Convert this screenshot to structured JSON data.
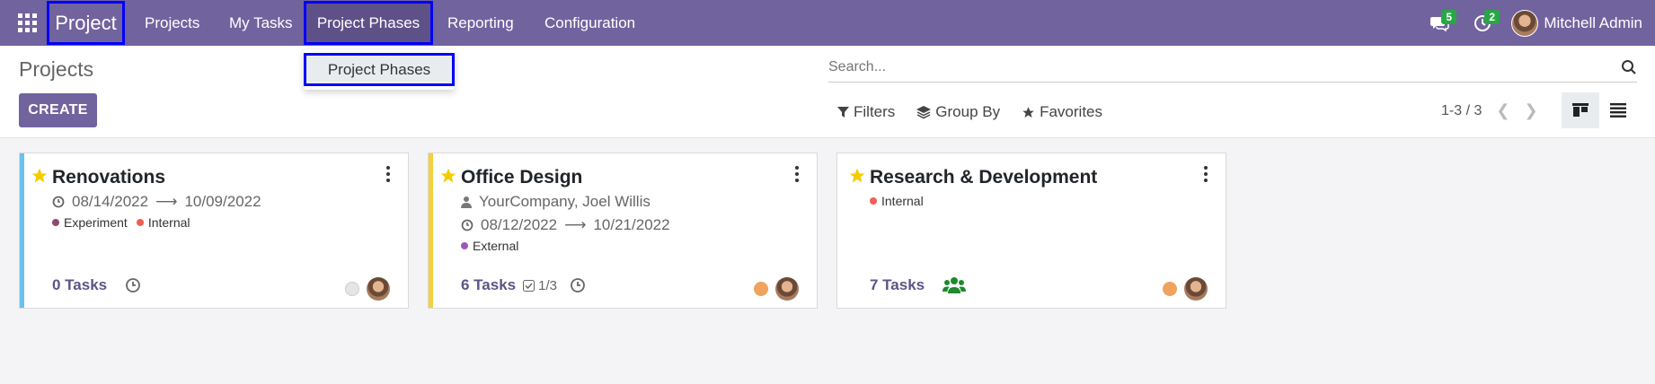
{
  "navbar": {
    "brand": "Project",
    "menu": [
      "Projects",
      "My Tasks",
      "Project Phases",
      "Reporting",
      "Configuration"
    ],
    "active_menu": "Project Phases",
    "messages_count": "5",
    "activities_count": "2",
    "user_name": "Mitchell Admin"
  },
  "dropdown": {
    "item": "Project Phases"
  },
  "control_panel": {
    "title": "Projects",
    "create_label": "CREATE",
    "search_placeholder": "Search...",
    "filters_label": "Filters",
    "group_by_label": "Group By",
    "favorites_label": "Favorites",
    "pager": "1-3 / 3"
  },
  "cards": [
    {
      "name": "Renovations",
      "stripe_color": "#6cc1ed",
      "partner": "",
      "date_start": "08/14/2022",
      "date_end": "10/09/2022",
      "tags": [
        {
          "label": "Experiment",
          "color": "#8c4a6e"
        },
        {
          "label": "Internal",
          "color": "#f06050"
        }
      ],
      "tasks": "0 Tasks",
      "subtasks": "",
      "status_color": "#e5e5e5"
    },
    {
      "name": "Office Design",
      "stripe_color": "#f4d03f",
      "partner": "YourCompany, Joel Willis",
      "date_start": "08/12/2022",
      "date_end": "10/21/2022",
      "tags": [
        {
          "label": "External",
          "color": "#9b59b6"
        }
      ],
      "tasks": "6 Tasks",
      "subtasks": "1/3",
      "status_color": "#f0a35e"
    },
    {
      "name": "Research & Development",
      "stripe_color": "",
      "partner": "",
      "date_start": "",
      "date_end": "",
      "tags": [
        {
          "label": "Internal",
          "color": "#f06050"
        }
      ],
      "tasks": "7 Tasks",
      "subtasks": "",
      "status_color": "#f0a35e"
    }
  ],
  "colors": {
    "brand": "#71639e",
    "favorite_star": "#f3cc00",
    "followers_icon": "#1e8a2e"
  }
}
